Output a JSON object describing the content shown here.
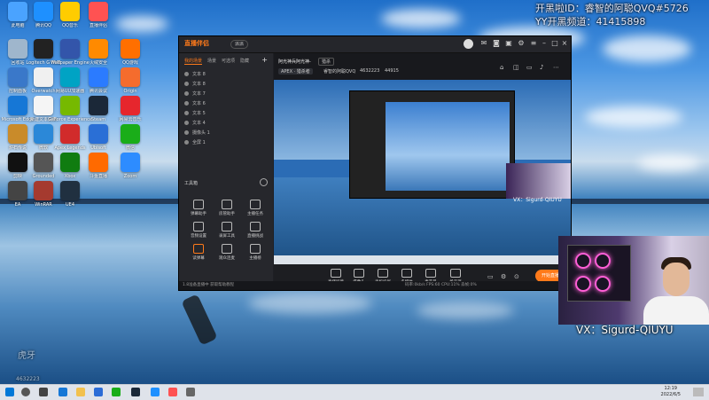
{
  "overlay": {
    "stream_id_line": "开黑啦ID：睿智的阿聪QVQ#5726",
    "yy_channel_line": "YY开黑频道：41415898",
    "wechat_line": "VX：Sigurd-QIUYU",
    "wechat_small": "VX：Sigurd-QIUYU",
    "watermark_number": "4632223",
    "watermark_brand": "虎牙"
  },
  "desktop_icons": [
    {
      "name": "此电脑",
      "color": "#4aa3ff"
    },
    {
      "name": "腾讯QQ",
      "color": "#1e90ff"
    },
    {
      "name": "QQ音乐",
      "color": "#ffcc00"
    },
    {
      "name": "直播伴侣",
      "color": "#ff5252"
    },
    {
      "name": "回收站",
      "color": "#9fb6cc"
    },
    {
      "name": "Logitech G HUB",
      "color": "#222222"
    },
    {
      "name": "Wallpaper Engine",
      "color": "#3355aa"
    },
    {
      "name": "火绒安全",
      "color": "#ff8a00"
    },
    {
      "name": "QQ游戏",
      "color": "#ff6f00"
    },
    {
      "name": "控制面板",
      "color": "#3a78c9"
    },
    {
      "name": "Overwatch",
      "color": "#f0f0f0"
    },
    {
      "name": "网易UU加速器",
      "color": "#00a3c4"
    },
    {
      "name": "腾讯会议",
      "color": "#2b7bff"
    },
    {
      "name": "Origin",
      "color": "#f56c2d"
    },
    {
      "name": "Microsoft Edge",
      "color": "#1677d6"
    },
    {
      "name": "新建文本文档",
      "color": "#f5f5f5"
    },
    {
      "name": "GeForce Experience",
      "color": "#76b900"
    },
    {
      "name": "Steam",
      "color": "#1b2838"
    },
    {
      "name": "网易云音乐",
      "color": "#e6262d"
    },
    {
      "name": "炉石传说",
      "color": "#c98b2a"
    },
    {
      "name": "微软",
      "color": "#2b88d8"
    },
    {
      "name": "Apex Legends",
      "color": "#d12b2b"
    },
    {
      "name": "Ubisoft",
      "color": "#2a6fd6"
    },
    {
      "name": "微信",
      "color": "#1aad19"
    },
    {
      "name": "剪映",
      "color": "#111111"
    },
    {
      "name": "Grounded",
      "color": "#555555"
    },
    {
      "name": "Xbox",
      "color": "#107c10"
    },
    {
      "name": "斗鱼直播",
      "color": "#ff6a00"
    },
    {
      "name": "Zoom",
      "color": "#2d8cff"
    },
    {
      "name": "EA",
      "color": "#444444"
    },
    {
      "name": "WinRAR",
      "color": "#a53a2f"
    },
    {
      "name": "UE4",
      "color": "#203040"
    }
  ],
  "app": {
    "brand": "直播伴侣",
    "badge": "派派",
    "left_tabs": [
      "我的场景",
      "场景",
      "可选项",
      "隐藏"
    ],
    "sources": [
      "文本 8",
      "文本 8",
      "文本 7",
      "文本 6",
      "文本 5",
      "文本 4",
      "摄像头 1",
      "全屏 1"
    ],
    "tools_label": "工具箱",
    "tools": [
      "弹幕助手",
      "房管助手",
      "主播任务",
      "音频设置",
      "录屏工具",
      "直播挑战",
      "读弹幕",
      "观众连麦",
      "主播榜"
    ],
    "room_title": "阿光神兵阿光神-",
    "room_tag": "猎杀",
    "game_tag": "APEX · 猎杀者",
    "room_streamer": "睿智的阿聪QVQ",
    "room_id": "4632223",
    "fans": "44915",
    "bottom_tools": [
      "直播屏幕",
      "摄像头",
      "手机投屏",
      "多媒体",
      "麦克风",
      "扬声器"
    ],
    "go_live": "开始直播",
    "status_bar": "1.8准备直播中 获取帮助教程",
    "status_right": "码率:0kb/s  FPS:60  CPU:11%  丢帧:0%"
  },
  "taskbar": {
    "time": "12:19",
    "date": "2022/6/5"
  }
}
